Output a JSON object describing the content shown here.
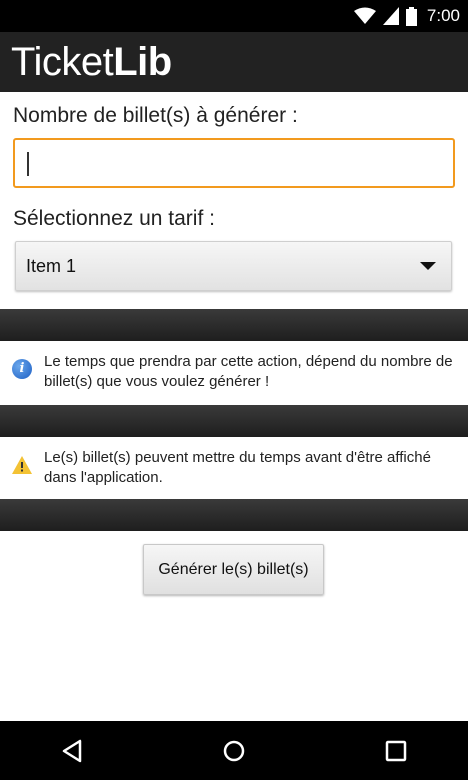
{
  "status_bar": {
    "time": "7:00",
    "icons": [
      "wifi-icon",
      "signal-icon",
      "battery-icon"
    ]
  },
  "app_bar": {
    "title_regular": "Ticket",
    "title_bold": "Lib",
    "background": "#222222"
  },
  "form": {
    "quantity_label": "Nombre de billet(s) à générer :",
    "quantity_value": "",
    "accent_color": "#f29a1e",
    "tarif_label": "Sélectionnez un tarif :",
    "tarif_selected": "Item 1"
  },
  "notes": [
    {
      "icon": "info-icon",
      "text": "Le temps que prendra par cette action, dépend du nombre de billet(s) que vous voulez générer !"
    },
    {
      "icon": "warning-icon",
      "text": "Le(s) billet(s) peuvent mettre du temps avant d'être affiché dans l'application."
    }
  ],
  "generate_button": {
    "label": "Générer le(s) billet(s)"
  },
  "nav_bar": {
    "buttons": [
      "back-icon",
      "home-icon",
      "recents-icon"
    ]
  }
}
